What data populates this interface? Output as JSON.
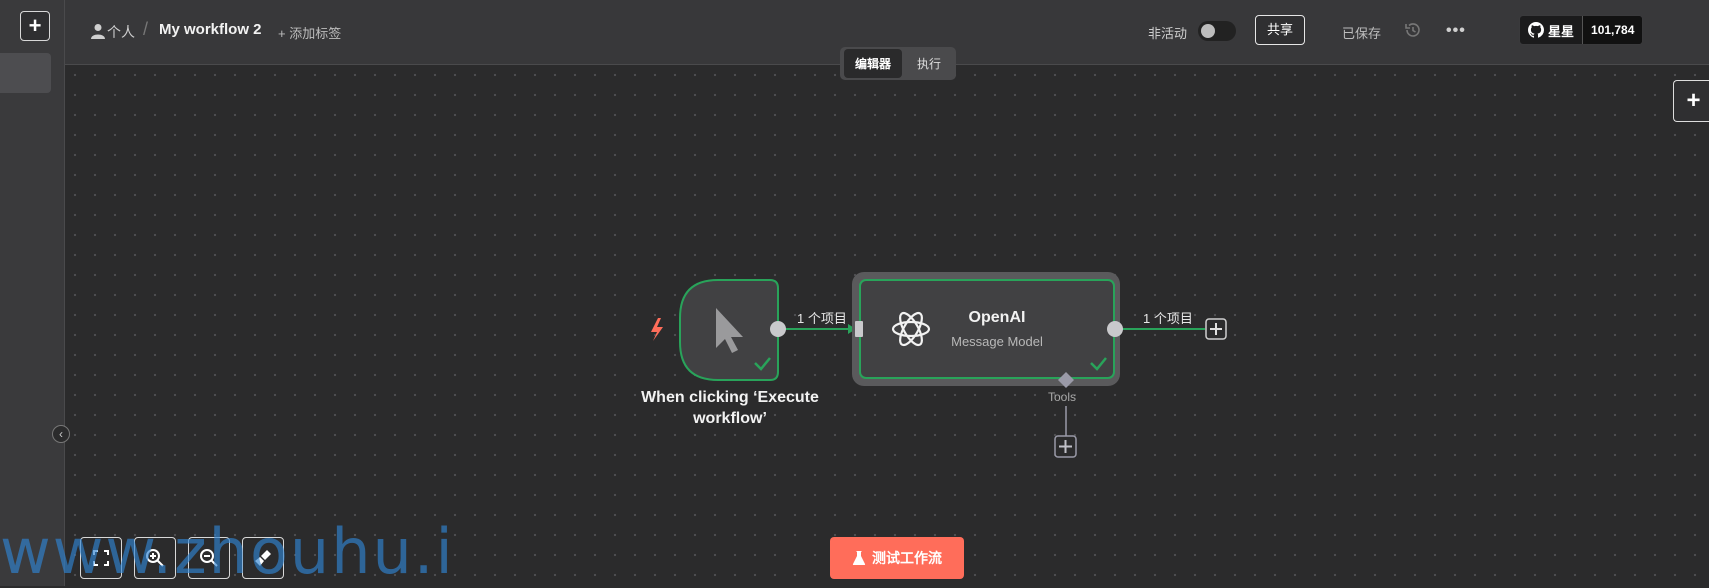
{
  "sidebar": {
    "add_label": "+"
  },
  "header": {
    "owner": "个人",
    "separator": "/",
    "workflow_name": "My workflow 2",
    "add_tag": "+ 添加标签",
    "active_label": "非活动",
    "share": "共享",
    "saved": "已保存",
    "more": "•••",
    "github_label": "星星",
    "github_count": "101,784"
  },
  "tabs": {
    "editor": "编辑器",
    "executions": "执行"
  },
  "canvas": {
    "trigger_node": {
      "title_line1": "When clicking ‘Execute",
      "title_line2": "workflow’"
    },
    "connection1_label": "1 个项目",
    "openai_node": {
      "title": "OpenAI",
      "subtitle": "Message Model"
    },
    "connection2_label": "1 个项目",
    "tools_label": "Tools",
    "test_button": "测试工作流",
    "right_add": "+"
  },
  "colors": {
    "accent": "#ff6d5a",
    "success": "#29a35a",
    "canvas_bg": "#2b2b2c"
  },
  "watermark": "www.zhouhu.i"
}
